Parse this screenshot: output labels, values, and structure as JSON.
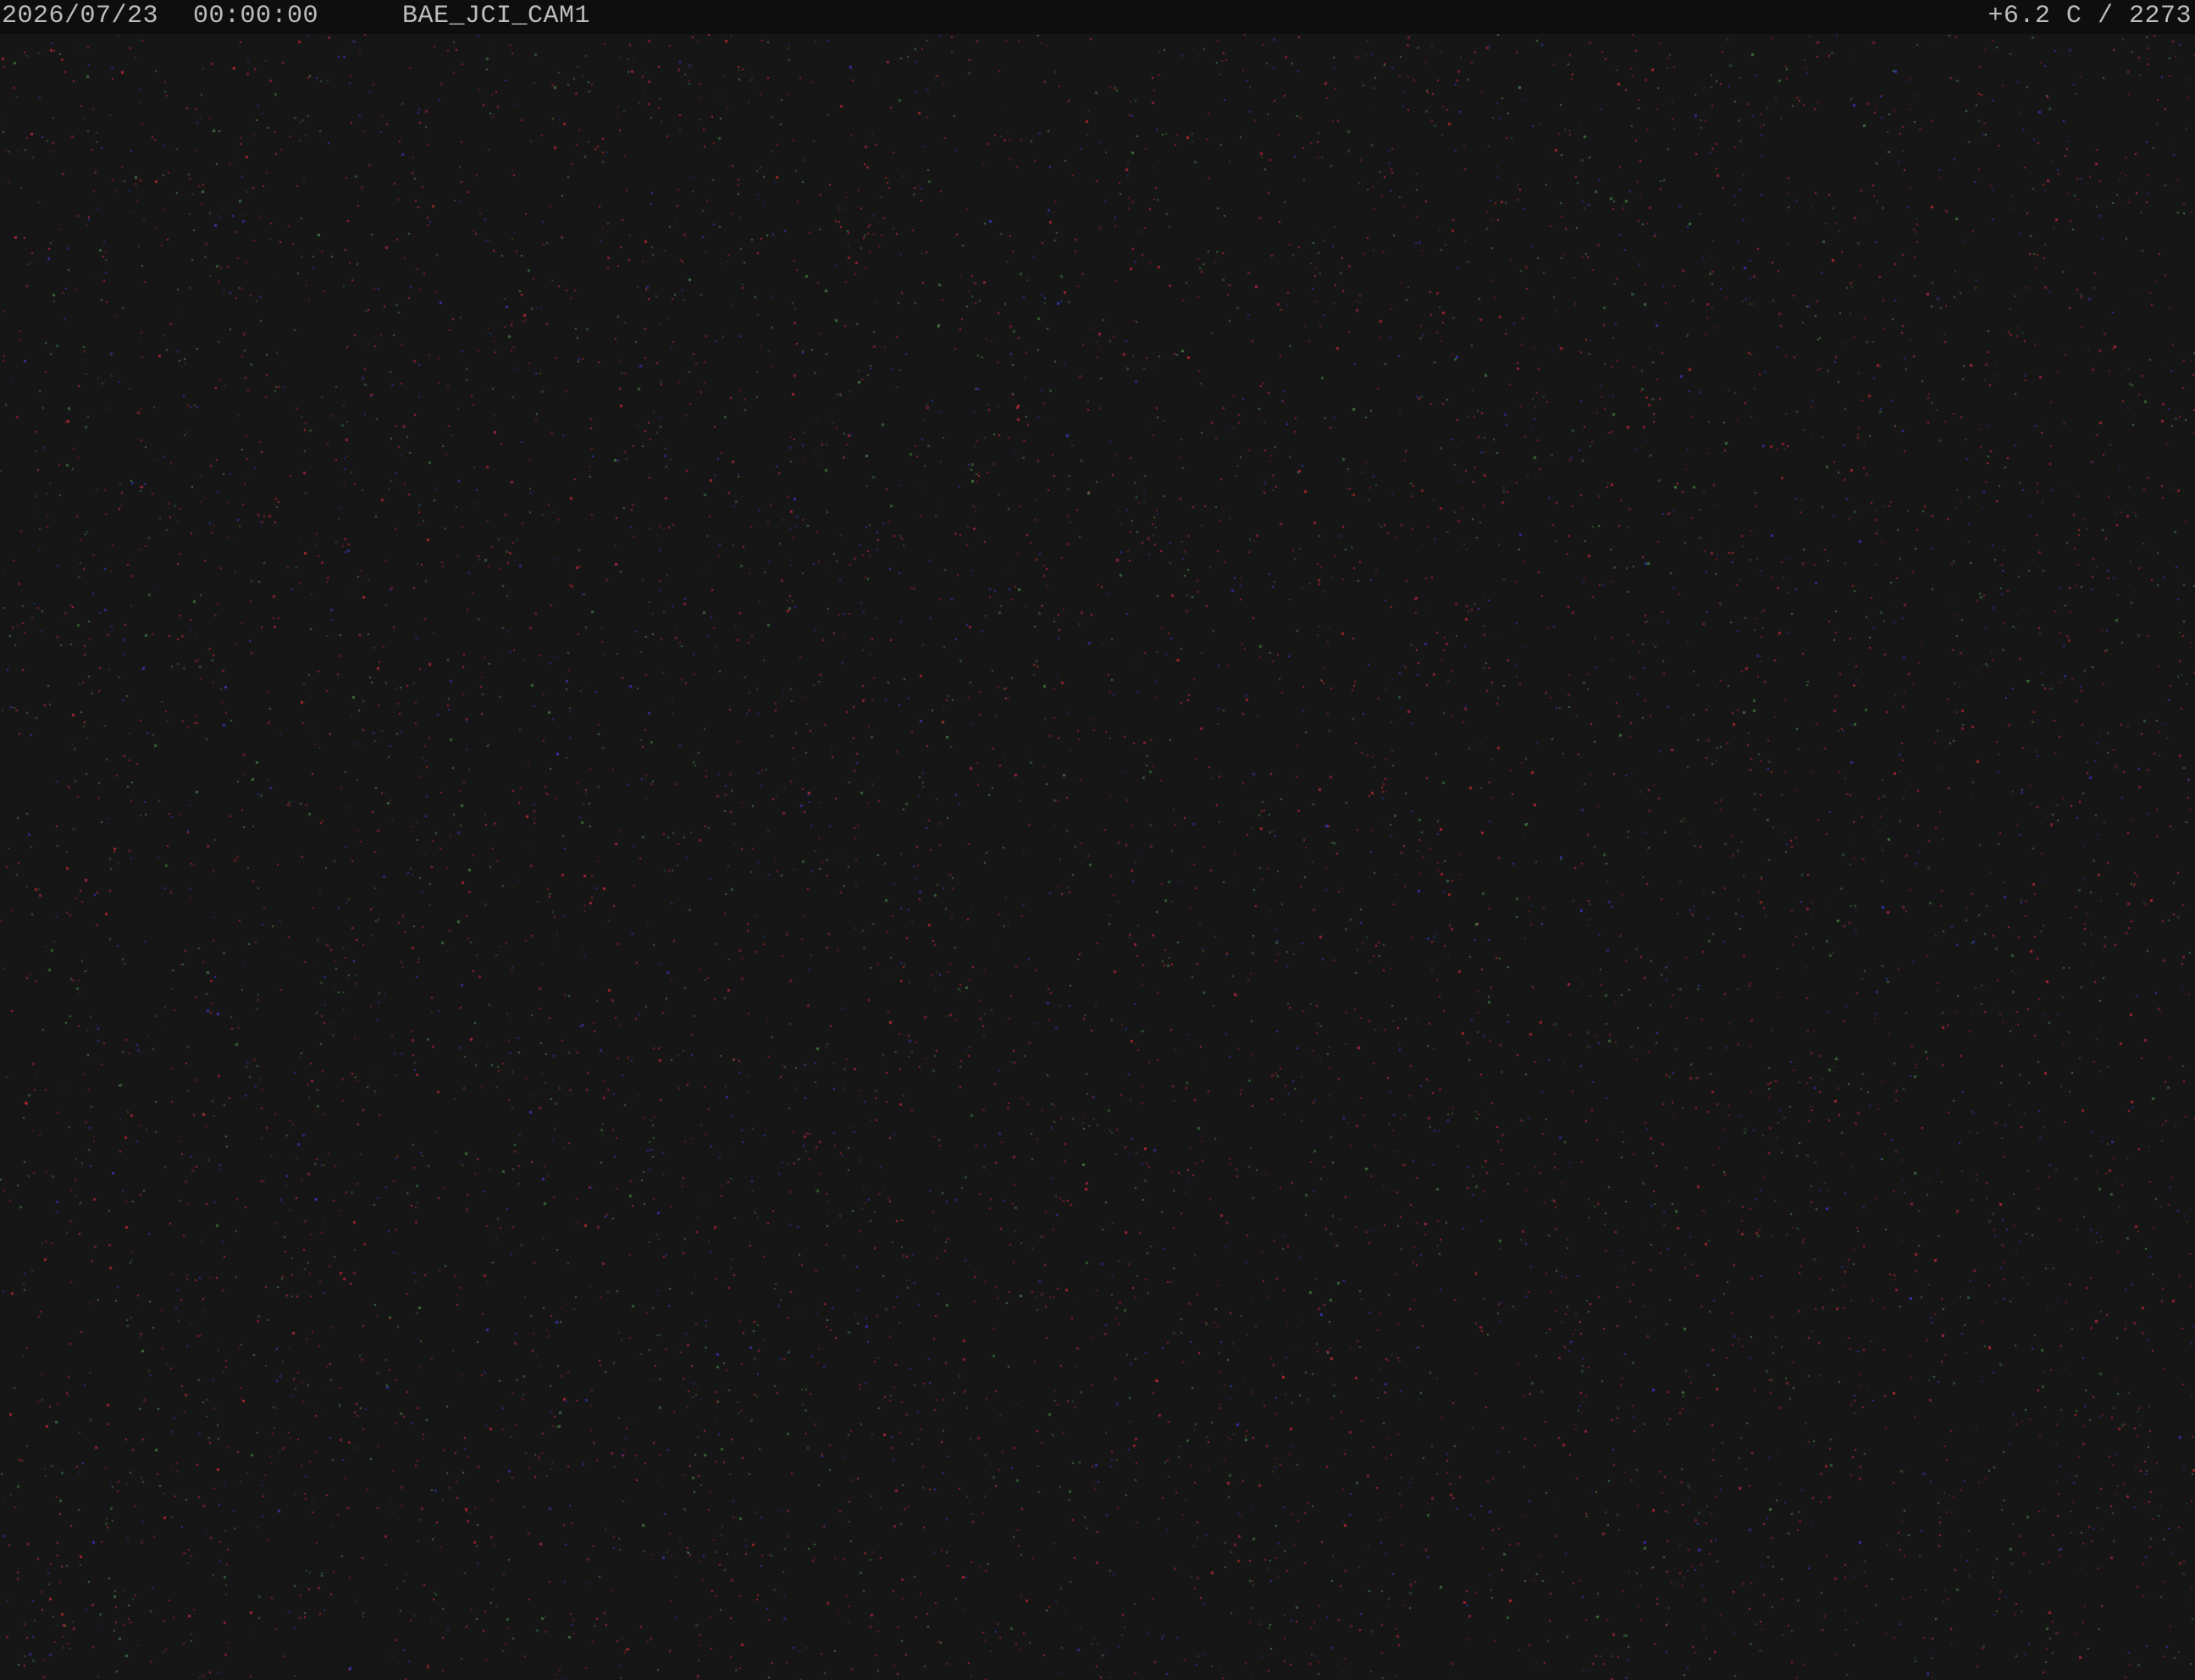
{
  "overlay": {
    "date": "2026/07/23",
    "time": "00:00:00",
    "camera_name": "BAE_JCI_CAM1",
    "temperature": "+6.2 C",
    "separator": "/",
    "frame_value": "2273"
  },
  "colors": {
    "background": "#161616",
    "overlay_bar": "#0e0e0e",
    "overlay_text": "#bdbdbd",
    "noise_red": "#d0283c",
    "noise_green": "#4a8a4a",
    "noise_blue": "#3a3ad0"
  }
}
